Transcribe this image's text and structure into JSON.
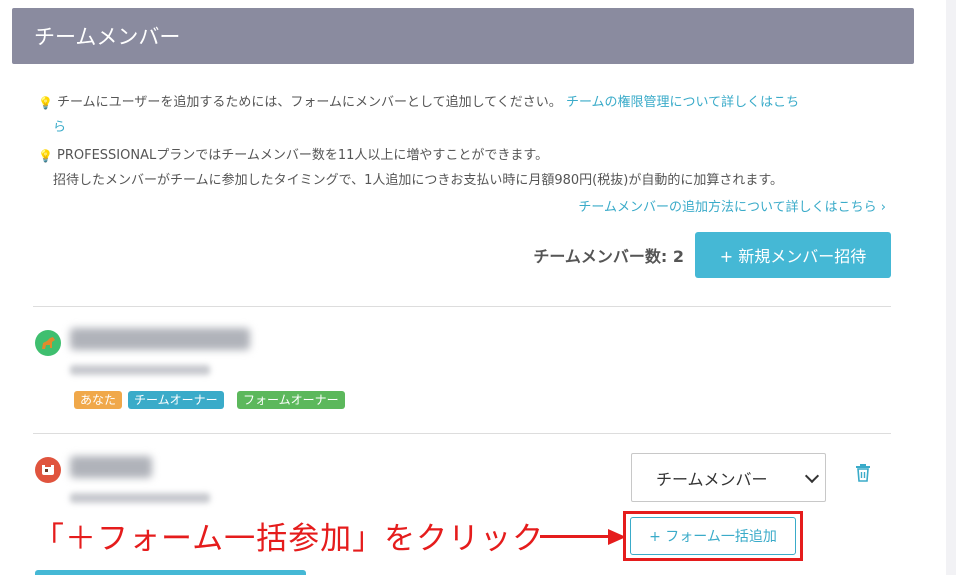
{
  "header": {
    "title": "チームメンバー"
  },
  "notes": {
    "line1": "チームにユーザーを追加するためには、フォームにメンバーとして追加してください。",
    "line1_link_a": "チームの権限管理について詳しくはこち",
    "line1_link_b": "ら",
    "line2": "PROFESSIONALプランではチームメンバー数を11人以上に増やすことができます。",
    "line3": "招待したメンバーがチームに参加したタイミングで、1人追加につきお支払い時に月額980円(税抜)が自動的に加算されます。",
    "howto_link": "チームメンバーの追加方法について詳しくはこちら",
    "bulb_icon": "lightbulb-icon"
  },
  "members_toolbar": {
    "count_label": "チームメンバー数: 2",
    "invite_button": "+ 新規メンバー招待"
  },
  "members": [
    {
      "avatar_icon": "horse-avatar-icon",
      "avatar_color": "#3fbf6f",
      "badges": [
        {
          "label": "あなた",
          "color": "#f0a84a"
        },
        {
          "label": "チームオーナー",
          "color": "#3aabc9"
        },
        {
          "label": "フォームオーナー",
          "color": "#5cb85c"
        }
      ]
    },
    {
      "avatar_icon": "cow-avatar-icon",
      "avatar_color": "#e0543e",
      "role_select": {
        "value": "チームメンバー"
      },
      "bulk_add_button": "+ フォーム一括追加"
    }
  ],
  "annotation": {
    "text": "「＋フォーム一括参加」をクリック",
    "color": "#e51c1c"
  },
  "colors": {
    "header_bg": "#8a8b9f",
    "accent": "#45b8d5",
    "link": "#3aabc9"
  }
}
